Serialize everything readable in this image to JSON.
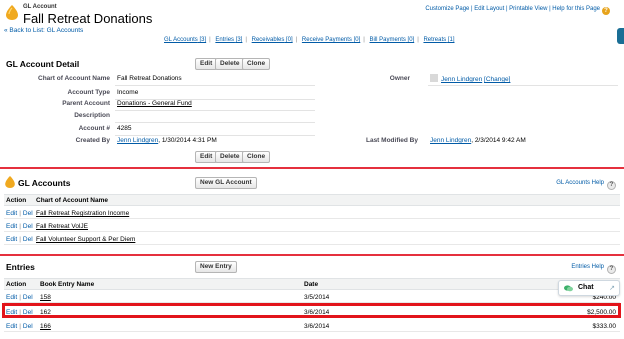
{
  "header": {
    "object_type": "GL Account",
    "title": "Fall Retreat Donations",
    "back_link": "« Back to List: GL Accounts",
    "top_links": "Customize Page | Edit Layout | Printable View | Help for this Page",
    "help_glyph": "?"
  },
  "related_links": [
    {
      "label": "GL Accounts",
      "count": "[3]"
    },
    {
      "label": "Entries",
      "count": "[3]"
    },
    {
      "label": "Receivables",
      "count": "[0]"
    },
    {
      "label": "Receive Payments",
      "count": "[0]"
    },
    {
      "label": "Bill Payments",
      "count": "[0]"
    },
    {
      "label": "Retreats",
      "count": "[1]"
    }
  ],
  "detail": {
    "title": "GL Account Detail",
    "buttons": {
      "edit": "Edit",
      "delete": "Delete",
      "clone": "Clone"
    },
    "fields": {
      "chart_label": "Chart of Account Name",
      "chart_value": "Fall Retreat Donations",
      "type_label": "Account Type",
      "type_value": "Income",
      "parent_label": "Parent Account",
      "parent_value": "Donations - General Fund",
      "desc_label": "Description",
      "desc_value": "",
      "number_label": "Account #",
      "number_value": "4285",
      "created_label": "Created By",
      "created_user": "Jenn Lindgren",
      "created_date": ", 1/30/2014 4:31 PM",
      "owner_label": "Owner",
      "owner_name": "Jenn Lindgren",
      "owner_change": "[Change]",
      "modified_label": "Last Modified By",
      "modified_user": "Jenn Lindgren",
      "modified_date": ", 2/3/2014 9:42 AM"
    }
  },
  "gl_accounts": {
    "title": "GL Accounts",
    "new_button": "New GL Account",
    "help": "GL Accounts Help",
    "col_action": "Action",
    "col_name": "Chart of Account Name",
    "action_edit": "Edit",
    "action_del": "Del",
    "rows": [
      "Fall Retreat Registration Income",
      "Fall Retreat VolJE",
      "Fall Volunteer Support & Per Diem"
    ]
  },
  "entries": {
    "title": "Entries",
    "new_button": "New Entry",
    "help": "Entries Help",
    "col_action": "Action",
    "col_name": "Book Entry Name",
    "col_date": "Date",
    "rows": [
      {
        "name": "158",
        "date": "3/5/2014",
        "amount": "$240.00"
      },
      {
        "name": "162",
        "date": "3/6/2014",
        "amount": "$2,500.00"
      },
      {
        "name": "166",
        "date": "3/6/2014",
        "amount": "$333.00"
      }
    ]
  },
  "chat": {
    "label": "Chat",
    "arrow": "↗"
  },
  "colors": {
    "accent_red": "#e5303d",
    "link": "#015ba7",
    "highlight": "#e2141b"
  }
}
